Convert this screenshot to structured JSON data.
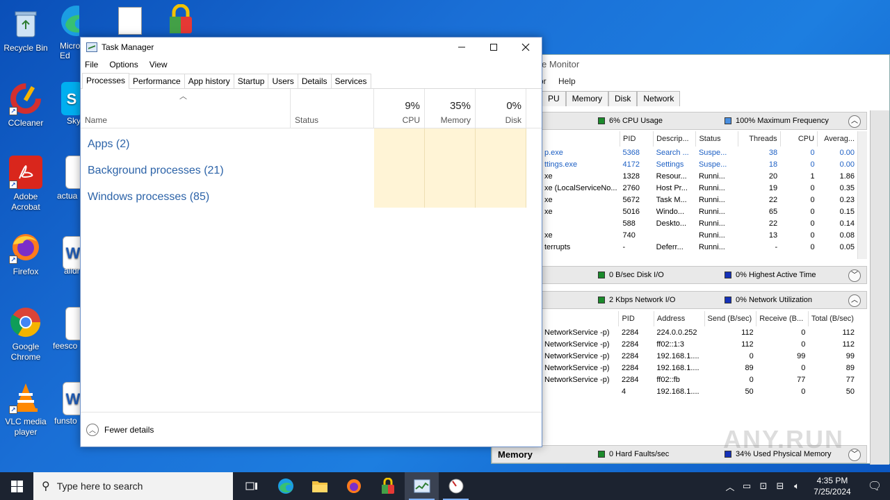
{
  "desktop": {
    "icons": [
      {
        "label": "Recycle Bin",
        "icon": "recycle-bin-icon"
      },
      {
        "label": "CCleaner",
        "icon": "ccleaner-icon"
      },
      {
        "label": "Adobe Acrobat",
        "icon": "adobe-acrobat-icon"
      },
      {
        "label": "Firefox",
        "icon": "firefox-icon"
      },
      {
        "label": "Google Chrome",
        "icon": "chrome-icon"
      },
      {
        "label": "VLC media player",
        "icon": "vlc-icon"
      }
    ],
    "clipped_labels": {
      "edge": "Micro\nEd",
      "skype": "Sky",
      "actual": "actua",
      "alldr": "alldr",
      "feesco": "feesco",
      "funstor": "funsto"
    }
  },
  "resource_monitor": {
    "title": "e Monitor",
    "menu": [
      "or",
      "Help"
    ],
    "tabs": [
      "PU",
      "Memory",
      "Disk",
      "Network"
    ],
    "cpu_panel": {
      "legend1": "6% CPU Usage",
      "legend2": "100% Maximum Frequency"
    },
    "cpu_headers": [
      "PID",
      "Descrip...",
      "Status",
      "Threads",
      "CPU",
      "Averag..."
    ],
    "cpu_rows": [
      {
        "name": "p.exe",
        "pid": "5368",
        "desc": "Search ...",
        "status": "Suspe...",
        "threads": "38",
        "cpu": "0",
        "avg": "0.00",
        "blue": true
      },
      {
        "name": "ttings.exe",
        "pid": "4172",
        "desc": "Settings",
        "status": "Suspe...",
        "threads": "18",
        "cpu": "0",
        "avg": "0.00",
        "blue": true
      },
      {
        "name": "xe",
        "pid": "1328",
        "desc": "Resour...",
        "status": "Runni...",
        "threads": "20",
        "cpu": "1",
        "avg": "1.86",
        "blue": false
      },
      {
        "name": "xe (LocalServiceNo...",
        "pid": "2760",
        "desc": "Host Pr...",
        "status": "Runni...",
        "threads": "19",
        "cpu": "0",
        "avg": "0.35",
        "blue": false
      },
      {
        "name": "xe",
        "pid": "5672",
        "desc": "Task M...",
        "status": "Runni...",
        "threads": "22",
        "cpu": "0",
        "avg": "0.23",
        "blue": false
      },
      {
        "name": "xe",
        "pid": "5016",
        "desc": "Windo...",
        "status": "Runni...",
        "threads": "65",
        "cpu": "0",
        "avg": "0.15",
        "blue": false
      },
      {
        "name": "",
        "pid": "588",
        "desc": "Deskto...",
        "status": "Runni...",
        "threads": "22",
        "cpu": "0",
        "avg": "0.14",
        "blue": false
      },
      {
        "name": "xe",
        "pid": "740",
        "desc": "",
        "status": "Runni...",
        "threads": "13",
        "cpu": "0",
        "avg": "0.08",
        "blue": false
      },
      {
        "name": "terrupts",
        "pid": "-",
        "desc": "Deferr...",
        "status": "Runni...",
        "threads": "-",
        "cpu": "0",
        "avg": "0.05",
        "blue": false
      }
    ],
    "disk_panel": {
      "legend1": "0 B/sec Disk I/O",
      "legend2": "0% Highest Active Time"
    },
    "network_panel": {
      "legend1": "2 Kbps Network I/O",
      "legend2": "0% Network Utilization"
    },
    "net_headers": [
      "PID",
      "Address",
      "Send (B/sec)",
      "Receive (B...",
      "Total (B/sec)"
    ],
    "net_rows": [
      {
        "name": "NetworkService -p)",
        "pid": "2284",
        "addr": "224.0.0.252",
        "send": "112",
        "recv": "0",
        "total": "112"
      },
      {
        "name": "NetworkService -p)",
        "pid": "2284",
        "addr": "ff02::1:3",
        "send": "112",
        "recv": "0",
        "total": "112"
      },
      {
        "name": "NetworkService -p)",
        "pid": "2284",
        "addr": "192.168.1....",
        "send": "0",
        "recv": "99",
        "total": "99"
      },
      {
        "name": "NetworkService -p)",
        "pid": "2284",
        "addr": "192.168.1....",
        "send": "89",
        "recv": "0",
        "total": "89"
      },
      {
        "name": "NetworkService -p)",
        "pid": "2284",
        "addr": "ff02::fb",
        "send": "0",
        "recv": "77",
        "total": "77"
      },
      {
        "name": "",
        "pid": "4",
        "addr": "192.168.1....",
        "send": "50",
        "recv": "0",
        "total": "50"
      }
    ],
    "memory_panel": {
      "title": "Memory",
      "legend1": "0 Hard Faults/sec",
      "legend2": "34% Used Physical Memory"
    }
  },
  "task_manager": {
    "title": "Task Manager",
    "menu": [
      "File",
      "Options",
      "View"
    ],
    "tabs": [
      "Processes",
      "Performance",
      "App history",
      "Startup",
      "Users",
      "Details",
      "Services"
    ],
    "active_tab": "Processes",
    "columns": {
      "name": "Name",
      "status": "Status",
      "cpu_pct": "9%",
      "cpu_label": "CPU",
      "mem_pct": "35%",
      "mem_label": "Memory",
      "disk_pct": "0%",
      "disk_label": "Disk"
    },
    "groups": [
      "Apps (2)",
      "Background processes (21)",
      "Windows processes (85)"
    ],
    "footer": "Fewer details"
  },
  "taskbar": {
    "search_placeholder": "Type here to search",
    "time": "4:35 PM",
    "date": "7/25/2024"
  },
  "watermark": "ANY.RUN",
  "colors": {
    "accent": "#2c63a8",
    "heatmap": "#fff4d6",
    "taskbar": "#1c2330"
  }
}
